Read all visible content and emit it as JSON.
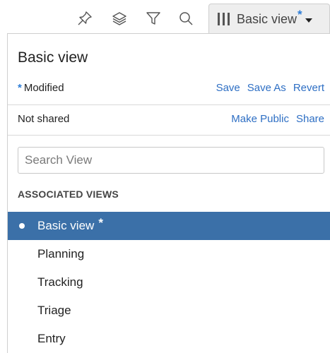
{
  "toolbar": {
    "icons": [
      "pin-icon",
      "layers-icon",
      "filter-icon",
      "search-icon"
    ],
    "view_button": {
      "label": "Basic view",
      "modified_marker": "*"
    }
  },
  "panel": {
    "title": "Basic view",
    "modified": {
      "marker": "*",
      "label": "Modified",
      "actions": [
        "Save",
        "Save As",
        "Revert"
      ]
    },
    "sharing": {
      "status": "Not shared",
      "actions": [
        "Make Public",
        "Share"
      ]
    },
    "search": {
      "placeholder": "Search View",
      "value": ""
    },
    "associated_views": {
      "heading": "ASSOCIATED VIEWS",
      "items": [
        {
          "label": "Basic view",
          "selected": true,
          "marker": "*"
        },
        {
          "label": "Planning",
          "selected": false
        },
        {
          "label": "Tracking",
          "selected": false
        },
        {
          "label": "Triage",
          "selected": false
        },
        {
          "label": "Entry",
          "selected": false
        }
      ]
    }
  },
  "colors": {
    "accent": "#2e7dd7",
    "link": "#2e6fc4",
    "selected_bg": "#3b70a8",
    "button_bg": "#eeeeee"
  }
}
